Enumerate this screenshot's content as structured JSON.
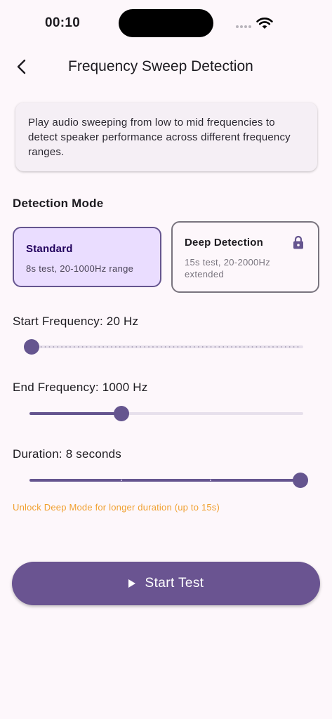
{
  "status_bar": {
    "time": "00:10"
  },
  "app_bar": {
    "title": "Frequency Sweep Detection",
    "back_icon": "chevron-left-icon"
  },
  "info_card": {
    "text": "Play audio sweeping from low to mid frequencies to detect speaker performance across different frequency ranges."
  },
  "detection_mode": {
    "title": "Detection Mode",
    "selected": "standard",
    "options": [
      {
        "id": "standard",
        "title": "Standard",
        "description": "8s test, 20-1000Hz range",
        "locked": false
      },
      {
        "id": "deep",
        "title": "Deep Detection",
        "description": "15s test, 20-2000Hz extended",
        "locked": true,
        "icon": "lock-icon"
      }
    ]
  },
  "sliders": {
    "start_frequency": {
      "label": "Start Frequency: 20 Hz",
      "value": 20,
      "min": 20,
      "max": 1000
    },
    "end_frequency": {
      "label": "End Frequency: 1000 Hz",
      "value": 1000,
      "min": 20,
      "max": 3000
    },
    "duration": {
      "label": "Duration: 8 seconds",
      "value": 8,
      "min": 5,
      "max": 8,
      "divisions": 3
    }
  },
  "unlock_hint": "Unlock Deep Mode for longer duration (up to 15s)",
  "start_button": {
    "label": "Start Test",
    "icon": "play-icon"
  },
  "colors": {
    "primary": "#65558f",
    "primary_container": "#eaddff",
    "background": "#fdf7fb",
    "warning": "#f0a030"
  }
}
